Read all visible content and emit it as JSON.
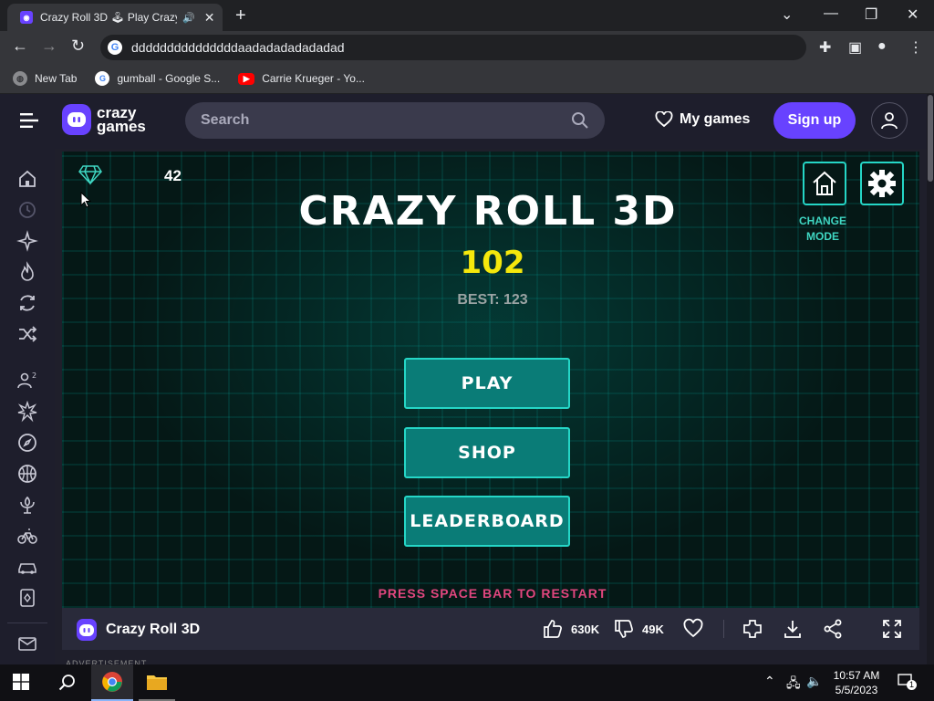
{
  "browser": {
    "tab_title": "Crazy Roll 3D 🕹 Play Crazy",
    "url": "dddddddddddddddaadadadadadadad",
    "bookmarks": [
      {
        "label": "New Tab"
      },
      {
        "label": "gumball - Google S..."
      },
      {
        "label": "Carrie Krueger - Yo..."
      }
    ]
  },
  "site": {
    "logo_line1": "crazy",
    "logo_line2": "games",
    "search_placeholder": "Search",
    "my_games_label": "My games",
    "signup_label": "Sign up"
  },
  "sidebar": {
    "icons": [
      "home-icon",
      "recent-icon",
      "new-icon",
      "trending-icon",
      "updated-icon",
      "random-icon",
      "multiplayer-icon",
      "action-icon",
      "adventure-icon",
      "basketball-icon",
      "beauty-icon",
      "bike-icon",
      "car-icon",
      "card-icon",
      "mail-icon"
    ]
  },
  "game": {
    "gem_count": "42",
    "title": "CRAZY ROLL 3D",
    "score": "102",
    "best": "BEST: 123",
    "buttons": {
      "play": "PLAY",
      "shop": "SHOP",
      "leaderboard": "LEADERBOARD"
    },
    "change_mode_line1": "CHANGE",
    "change_mode_line2": "MODE",
    "restart_hint": "PRESS SPACE BAR  TO RESTART"
  },
  "game_footer": {
    "title": "Crazy Roll 3D",
    "likes": "630K",
    "dislikes": "49K"
  },
  "ad_label": "ADVERTISEMENT",
  "taskbar": {
    "time": "10:57 AM",
    "date": "5/5/2023",
    "notification_count": "1"
  },
  "colors": {
    "brand_purple": "#6842ff",
    "game_teal": "#0a7c77",
    "score_yellow": "#f5e80c",
    "restart_pink": "#e0467e"
  }
}
